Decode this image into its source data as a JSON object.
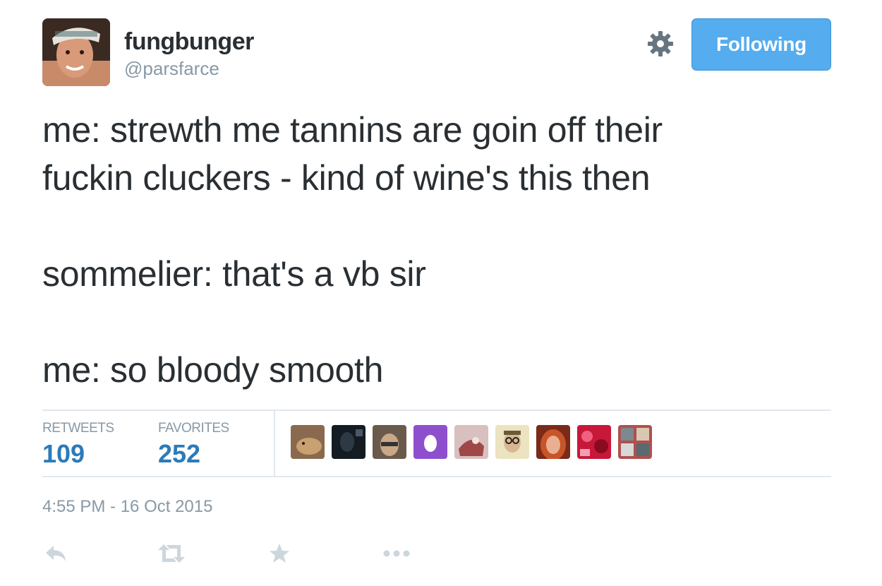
{
  "header": {
    "fullname": "fungbunger",
    "screen_name": "@parsfarce",
    "follow_button_label": "Following",
    "settings_icon": "gear-icon"
  },
  "tweet": {
    "lines": [
      "me: strewth me tannins are goin off their",
      "fuckin cluckers - kind of wine's this then",
      "sommelier: that's a vb sir",
      "me: so bloody smooth"
    ]
  },
  "stats": {
    "retweets_label": "RETWEETS",
    "retweets_count": "109",
    "favorites_label": "FAVORITES",
    "favorites_count": "252"
  },
  "favoriters": [
    {
      "name": "dog-avatar",
      "color": "#b58a5e"
    },
    {
      "name": "dark-silhouette-avatar",
      "color": "#1c2530"
    },
    {
      "name": "person-avatar",
      "color": "#8f7f6d"
    },
    {
      "name": "egg-avatar",
      "color": "#8e4fce"
    },
    {
      "name": "cartoon-avatar",
      "color": "#c9a0a0"
    },
    {
      "name": "glasses-man-avatar",
      "color": "#e8ddb0"
    },
    {
      "name": "red-hair-avatar",
      "color": "#c2502a"
    },
    {
      "name": "red-pattern-avatar",
      "color": "#c8183a"
    },
    {
      "name": "collage-avatar",
      "color": "#a84242"
    }
  ],
  "timestamp": "4:55 PM - 16 Oct 2015",
  "actions": {
    "reply_icon": "reply-icon",
    "retweet_icon": "retweet-icon",
    "favorite_icon": "star-icon",
    "more_icon": "more-icon"
  },
  "colors": {
    "accent": "#55acee",
    "link": "#2b7bb9",
    "muted": "#8899a6",
    "text": "#292f33",
    "border": "#e1e8ed",
    "action_icon": "#ccd6dd"
  }
}
